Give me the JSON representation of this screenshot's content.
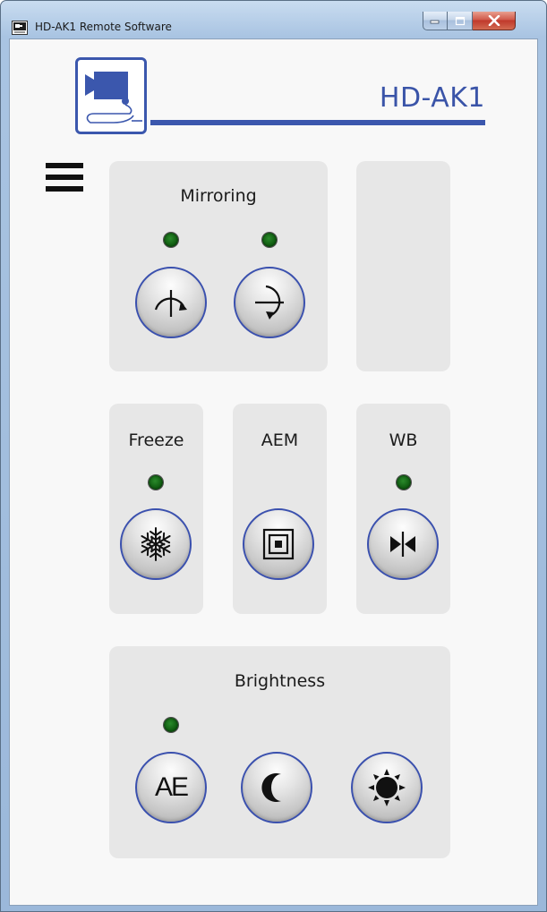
{
  "window": {
    "title": "HD-AK1 Remote Software",
    "controls": {
      "minimize": "minimize-icon",
      "maximize": "maximize-icon",
      "close": "close-icon"
    }
  },
  "header": {
    "logo_icon": "camera-logo-icon",
    "product_name": "HD-AK1",
    "accent_color": "#3b57ad"
  },
  "menu": {
    "icon": "hamburger-menu-icon"
  },
  "mirroring": {
    "title": "Mirroring",
    "buttons": [
      {
        "name": "mirror-horizontal",
        "icon": "flip-horizontal-icon",
        "indicator": "on"
      },
      {
        "name": "mirror-vertical",
        "icon": "flip-vertical-icon",
        "indicator": "on"
      }
    ]
  },
  "freeze": {
    "title": "Freeze",
    "icon": "snowflake-icon",
    "indicator": "on"
  },
  "aem": {
    "title": "AEM",
    "icon": "aem-metering-icon"
  },
  "wb": {
    "title": "WB",
    "icon": "white-balance-icon",
    "indicator": "on"
  },
  "brightness": {
    "title": "Brightness",
    "buttons": [
      {
        "name": "ae",
        "label": "AE",
        "indicator": "on"
      },
      {
        "name": "dark",
        "icon": "moon-icon"
      },
      {
        "name": "bright",
        "icon": "sun-icon"
      }
    ]
  },
  "colors": {
    "indicator_green": "#0f5a10",
    "panel_bg": "#e7e7e7",
    "button_ring": "#3a50ae"
  }
}
